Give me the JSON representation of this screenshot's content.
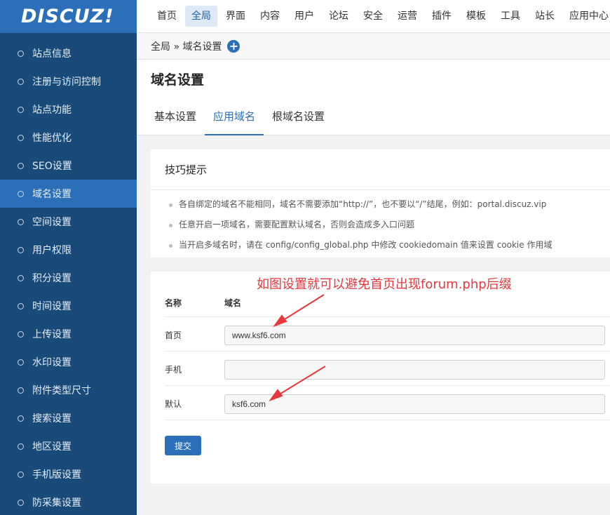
{
  "logo": "DISCUZ!",
  "sidebar": {
    "items": [
      {
        "label": "站点信息"
      },
      {
        "label": "注册与访问控制"
      },
      {
        "label": "站点功能"
      },
      {
        "label": "性能优化"
      },
      {
        "label": "SEO设置"
      },
      {
        "label": "域名设置",
        "active": true
      },
      {
        "label": "空间设置"
      },
      {
        "label": "用户权限"
      },
      {
        "label": "积分设置"
      },
      {
        "label": "时间设置"
      },
      {
        "label": "上传设置"
      },
      {
        "label": "水印设置"
      },
      {
        "label": "附件类型尺寸"
      },
      {
        "label": "搜索设置"
      },
      {
        "label": "地区设置"
      },
      {
        "label": "手机版设置"
      },
      {
        "label": "防采集设置"
      }
    ]
  },
  "topnav": {
    "items": [
      {
        "label": "首页"
      },
      {
        "label": "全局",
        "active": true
      },
      {
        "label": "界面"
      },
      {
        "label": "内容"
      },
      {
        "label": "用户"
      },
      {
        "label": "论坛"
      },
      {
        "label": "安全"
      },
      {
        "label": "运营"
      },
      {
        "label": "插件"
      },
      {
        "label": "模板"
      },
      {
        "label": "工具"
      },
      {
        "label": "站长"
      },
      {
        "label": "应用中心"
      }
    ]
  },
  "breadcrumb": {
    "text": "全局 » 域名设置",
    "plus": "+"
  },
  "page": {
    "title": "域名设置",
    "tabs": [
      {
        "label": "基本设置"
      },
      {
        "label": "应用域名",
        "active": true
      },
      {
        "label": "根域名设置"
      }
    ]
  },
  "tips": {
    "title": "技巧提示",
    "items": [
      "各自绑定的域名不能相同，域名不需要添加“http://”，也不要以“/”结尾，例如：portal.discuz.vip",
      "任意开启一项域名，需要配置默认域名，否则会造成多入口问题",
      "当开启多域名时，请在 config/config_global.php 中修改 cookiedomain 值来设置 cookie 作用域"
    ]
  },
  "form": {
    "header": {
      "name": "名称",
      "domain": "域名"
    },
    "rows": [
      {
        "label": "首页",
        "value": "www.ksf6.com"
      },
      {
        "label": "手机",
        "value": ""
      },
      {
        "label": "默认",
        "value": "ksf6.com"
      }
    ],
    "submit": "提交"
  },
  "annotation": {
    "text": "如图设置就可以避免首页出现forum.php后缀",
    "color": "#e8383d"
  }
}
